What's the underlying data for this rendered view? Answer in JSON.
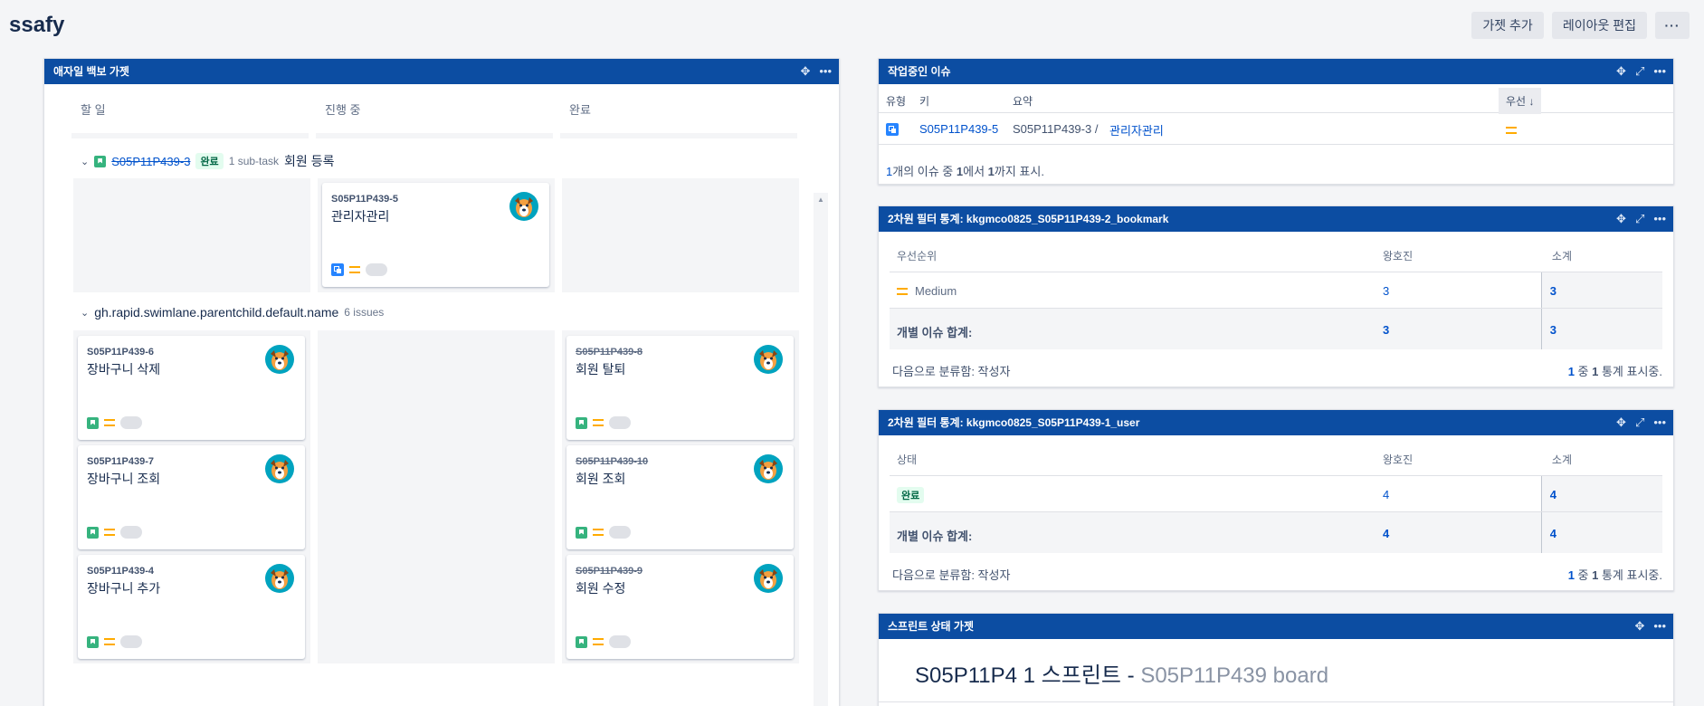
{
  "page": {
    "title": "ssafy",
    "actions": {
      "add_gadget": "가젯 추가",
      "edit_layout": "레이아웃 편집",
      "more": "···"
    }
  },
  "agile_gadget": {
    "title": "애자일 백보 가젯",
    "columns": [
      "할 일",
      "진행 중",
      "완료"
    ],
    "lane1": {
      "parent_key": "S05P11P439-3",
      "status": "완료",
      "subtask_count": "1 sub-task",
      "summary": "회원 등록",
      "cards": [
        {
          "key": "S05P11P439-5",
          "summary": "관리자관리"
        }
      ]
    },
    "lane2": {
      "name": "gh.rapid.swimlane.parentchild.default.name",
      "count": "6 issues",
      "todo": [
        {
          "key": "S05P11P439-6",
          "summary": "장바구니 삭제"
        },
        {
          "key": "S05P11P439-7",
          "summary": "장바구니 조회"
        },
        {
          "key": "S05P11P439-4",
          "summary": "장바구니 추가"
        }
      ],
      "done": [
        {
          "key": "S05P11P439-8",
          "summary": "회원 탈퇴"
        },
        {
          "key": "S05P11P439-10",
          "summary": "회원 조회"
        },
        {
          "key": "S05P11P439-9",
          "summary": "회원 수정"
        }
      ]
    }
  },
  "in_progress_gadget": {
    "title": "작업중인 이슈",
    "headers": {
      "type": "유형",
      "key": "키",
      "summary": "요약",
      "priority": "우선"
    },
    "row": {
      "key": "S05P11P439-5",
      "parent": "S05P11P439-3 /",
      "summary": "관리자관리"
    },
    "footer": {
      "a": "1",
      "b": "개의 이슈 중 ",
      "c": "1",
      "d": "에서 ",
      "e": "1",
      "f": "까지 표시."
    }
  },
  "stats1": {
    "title": "2차원 필터 통계: kkgmco0825_S05P11P439-2_bookmark",
    "col1": "우선순위",
    "col2": "왕호진",
    "col3": "소계",
    "row_label": "Medium",
    "row_v1": "3",
    "row_v2": "3",
    "total_label": "개별 이슈 합계:",
    "total_v1": "3",
    "total_v2": "3",
    "footer_left": "다음으로 분류함: 작성자",
    "footer_right": {
      "a": "1",
      "b": " 중 ",
      "c": "1",
      "d": " 통계 표시중."
    }
  },
  "stats2": {
    "title": "2차원 필터 통계: kkgmco0825_S05P11P439-1_user",
    "col1": "상태",
    "col2": "왕호진",
    "col3": "소계",
    "row_label": "완료",
    "row_v1": "4",
    "row_v2": "4",
    "total_label": "개별 이슈 합계:",
    "total_v1": "4",
    "total_v2": "4",
    "footer_left": "다음으로 분류함: 작성자",
    "footer_right": {
      "a": "1",
      "b": " 중 ",
      "c": "1",
      "d": " 통계 표시중."
    }
  },
  "sprint_gadget": {
    "title": "스프린트 상태 가젯",
    "sprint_name": "S05P11P4 1 스프린트",
    "separator": " - ",
    "board_name": "S05P11P439 board"
  },
  "colors": {
    "header_blue": "#0c4da2",
    "link": "#0052cc",
    "priority_medium": "#ffab00",
    "done_green": "#006644"
  }
}
